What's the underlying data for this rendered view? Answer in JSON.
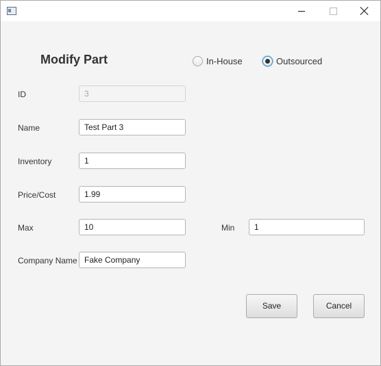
{
  "window": {
    "title": ""
  },
  "header": {
    "title": "Modify Part"
  },
  "source_radio": {
    "in_house_label": "In-House",
    "outsourced_label": "Outsourced",
    "selected": "Outsourced"
  },
  "form": {
    "id": {
      "label": "ID",
      "value": "3"
    },
    "name": {
      "label": "Name",
      "value": "Test Part 3"
    },
    "inventory": {
      "label": "Inventory",
      "value": "1"
    },
    "price": {
      "label": "Price/Cost",
      "value": "1.99"
    },
    "max": {
      "label": "Max",
      "value": "10"
    },
    "min": {
      "label": "Min",
      "value": "1"
    },
    "company": {
      "label": "Company Name",
      "value": "Fake Company"
    }
  },
  "buttons": {
    "save": "Save",
    "cancel": "Cancel"
  }
}
